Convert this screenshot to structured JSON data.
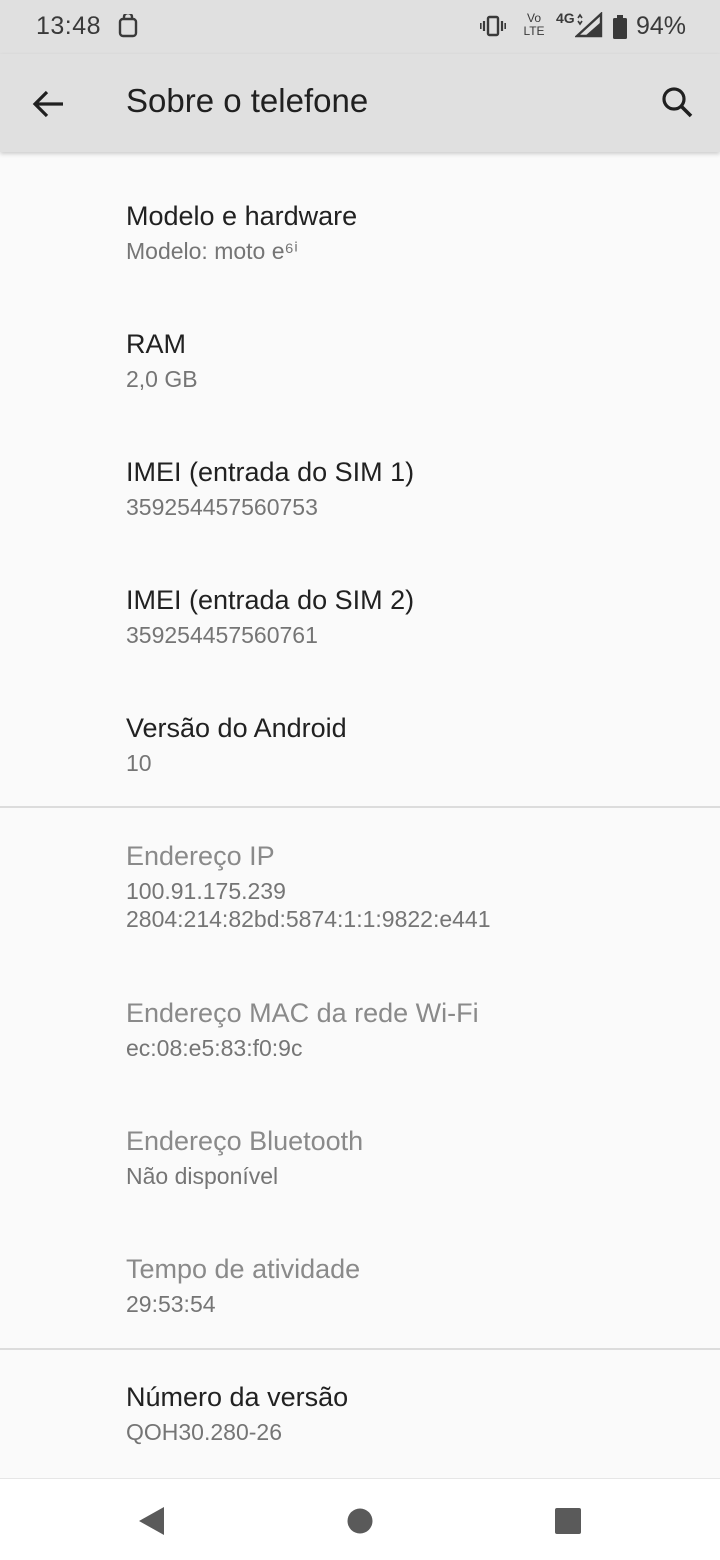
{
  "status_bar": {
    "time": "13:48",
    "volte_top": "Vo",
    "volte_bottom": "LTE",
    "network": "4G",
    "battery": "94%"
  },
  "toolbar": {
    "title": "Sobre o telefone",
    "back_icon": "arrow-back-icon",
    "search_icon": "search-icon"
  },
  "items": [
    {
      "title": "Modelo e hardware",
      "summary": "Modelo: moto e⁶ⁱ",
      "enabled": true
    },
    {
      "title": "RAM",
      "summary": "2,0 GB",
      "enabled": true
    },
    {
      "title": "IMEI (entrada do SIM 1)",
      "summary": "359254457560753",
      "enabled": true
    },
    {
      "title": "IMEI (entrada do SIM 2)",
      "summary": "359254457560761",
      "enabled": true
    },
    {
      "title": "Versão do Android",
      "summary": "10",
      "enabled": true
    },
    {
      "title": "Endereço IP",
      "summary_line1": "100.91.175.239",
      "summary_line2": "2804:214:82bd:5874:1:1:9822:e441",
      "enabled": false
    },
    {
      "title": "Endereço MAC da rede Wi-Fi",
      "summary": "ec:08:e5:83:f0:9c",
      "enabled": false
    },
    {
      "title": "Endereço Bluetooth",
      "summary": "Não disponível",
      "enabled": false
    },
    {
      "title": "Tempo de atividade",
      "summary": "29:53:54",
      "enabled": false
    },
    {
      "title": "Número da versão",
      "summary": "QOH30.280-26",
      "enabled": true
    }
  ],
  "nav_bar": {
    "back_icon": "nav-back-icon",
    "home_icon": "nav-home-icon",
    "recents_icon": "nav-recents-icon"
  },
  "colors": {
    "toolbar_bg": "#e0e0e0",
    "page_bg": "#fafafa",
    "title_text": "#212121",
    "summary_text": "#757575"
  }
}
